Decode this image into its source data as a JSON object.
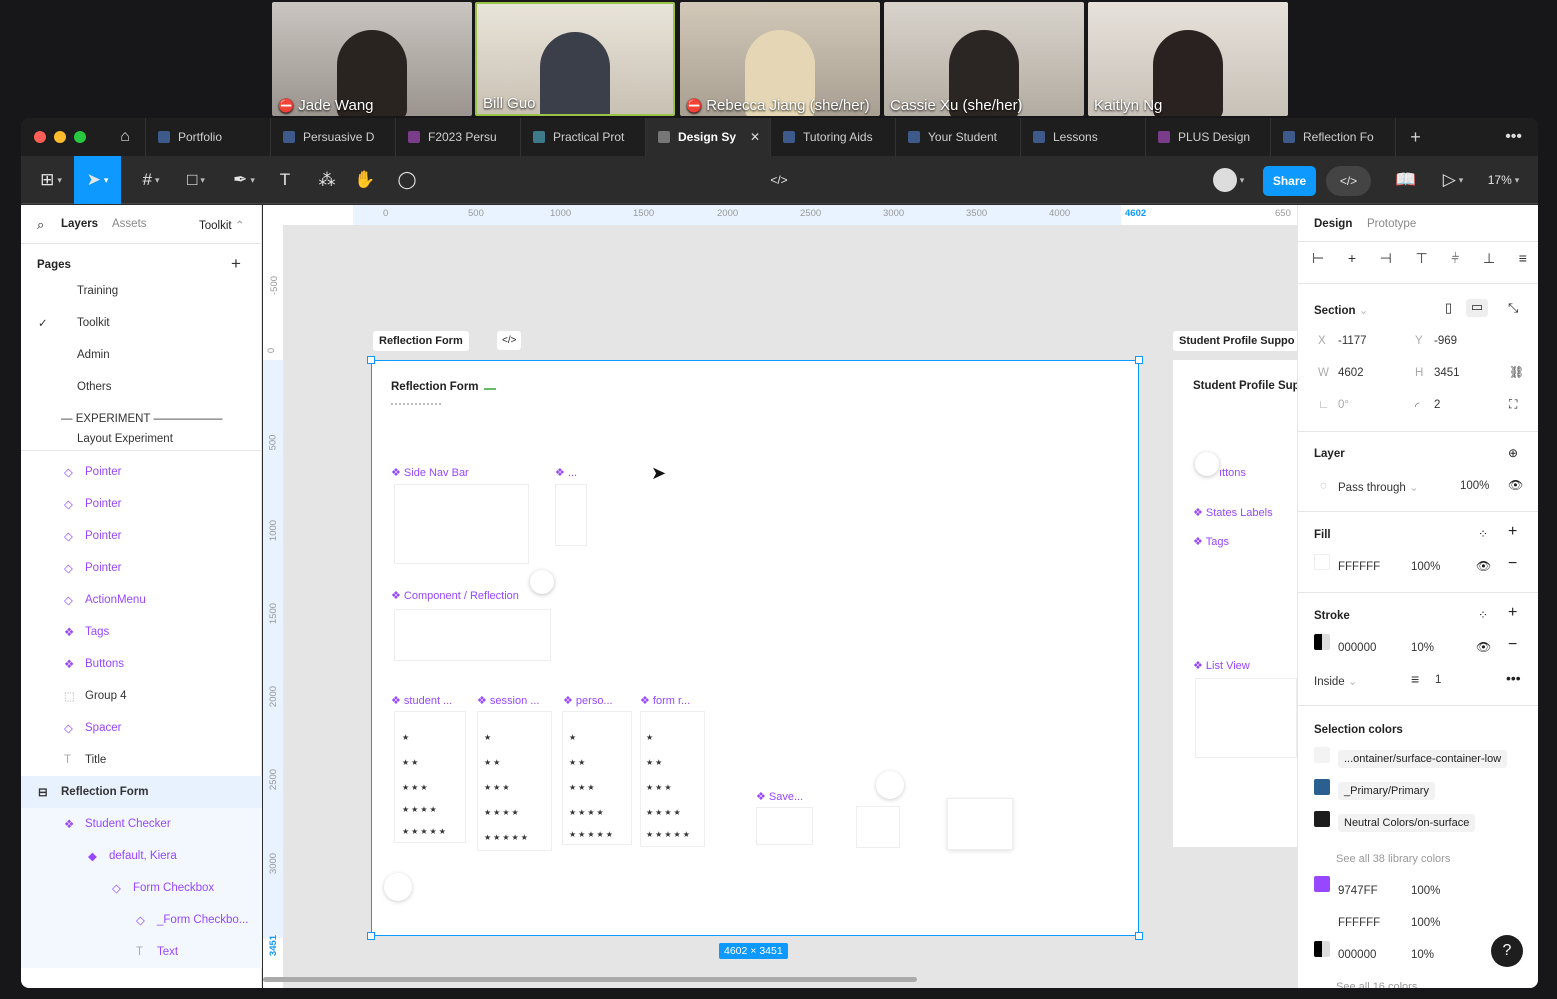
{
  "participants": [
    {
      "name": "Jade Wang",
      "muted": true
    },
    {
      "name": "Bill Guo",
      "muted": false
    },
    {
      "name": "Rebecca Jiang (she/her)",
      "muted": true
    },
    {
      "name": "Cassie Xu (she/her)",
      "muted": false
    },
    {
      "name": "Kaitlyn Ng",
      "muted": false
    }
  ],
  "tabs": [
    "Portfolio",
    "Persuasive D",
    "F2023 Persu",
    "Practical Prot",
    "Design Sy",
    "Tutoring Aids",
    "Your Student",
    "Lessons",
    "PLUS Design",
    "Reflection Fo"
  ],
  "toolbar": {
    "share": "Share",
    "zoom": "17%",
    "code_icon": "</>"
  },
  "left": {
    "tabs": {
      "layers": "Layers",
      "assets": "Assets",
      "file": "Toolkit"
    },
    "pages_title": "Pages",
    "pages": [
      "Training",
      "Toolkit",
      "Admin",
      "Others",
      "— EXPERIMENT ——————",
      "Layout Experiment"
    ],
    "layers": [
      "Pointer",
      "Pointer",
      "Pointer",
      "Pointer",
      "ActionMenu",
      "Tags",
      "Buttons",
      "Group 4",
      "Spacer",
      "Title",
      "Reflection Form",
      "Student Checker",
      "default, Kiera",
      "Form Checkbox",
      "_Form Checkbo...",
      "Text"
    ]
  },
  "ruler": {
    "top": [
      "0",
      "500",
      "1000",
      "1500",
      "2000",
      "2500",
      "3000",
      "3500",
      "4000",
      "4602",
      "650"
    ],
    "left": [
      "-500",
      "0",
      "500",
      "1000",
      "1500",
      "2000",
      "2500",
      "3000",
      "3451"
    ]
  },
  "canvas": {
    "frame_label": "Reflection Form",
    "frame_title": "Reflection Form",
    "size_badge": "4602 × 3451",
    "side_frame_label": "Student Profile Suppo",
    "side_frame_title": "Student Profile Sup",
    "components": {
      "side_nav": "❖ Side Nav Bar",
      "dots": "❖ ...",
      "component": "❖ Component / Reflection",
      "student": "❖ student ...",
      "session": "❖ session ...",
      "perso": "❖ perso...",
      "form": "❖ form r...",
      "save": "❖ Save...",
      "buttons": "ıttons",
      "states": "❖ States Labels",
      "tags": "❖ Tags",
      "list": "❖ List View"
    }
  },
  "right": {
    "tabs": {
      "design": "Design",
      "prototype": "Prototype"
    },
    "section": "Section",
    "x": "-1177",
    "y": "-969",
    "w": "4602",
    "h": "3451",
    "rotation": "0°",
    "radius": "2",
    "labels": {
      "x": "X",
      "y": "Y",
      "w": "W",
      "h": "H"
    },
    "layer_title": "Layer",
    "blend": "Pass through",
    "opacity": "100%",
    "fill_title": "Fill",
    "fill_hex": "FFFFFF",
    "fill_pct": "100%",
    "stroke_title": "Stroke",
    "stroke_hex": "000000",
    "stroke_pct": "10%",
    "stroke_pos": "Inside",
    "stroke_w": "1",
    "sel_title": "Selection colors",
    "sel": [
      {
        "name": "...ontainer/surface-container-low",
        "color": "#f3f3f3"
      },
      {
        "name": "_Primary/Primary",
        "color": "#2a5f8f"
      },
      {
        "name": "Neutral Colors/on-surface",
        "color": "#1c1c1c"
      }
    ],
    "see_all": "See all 38 library colors",
    "raw": [
      {
        "hex": "9747FF",
        "pct": "100%",
        "color": "#9747ff"
      },
      {
        "hex": "FFFFFF",
        "pct": "100%",
        "color": "#ffffff"
      },
      {
        "hex": "000000",
        "pct": "10%",
        "color": "#000000"
      }
    ],
    "see_more": "See all 16 colors"
  }
}
